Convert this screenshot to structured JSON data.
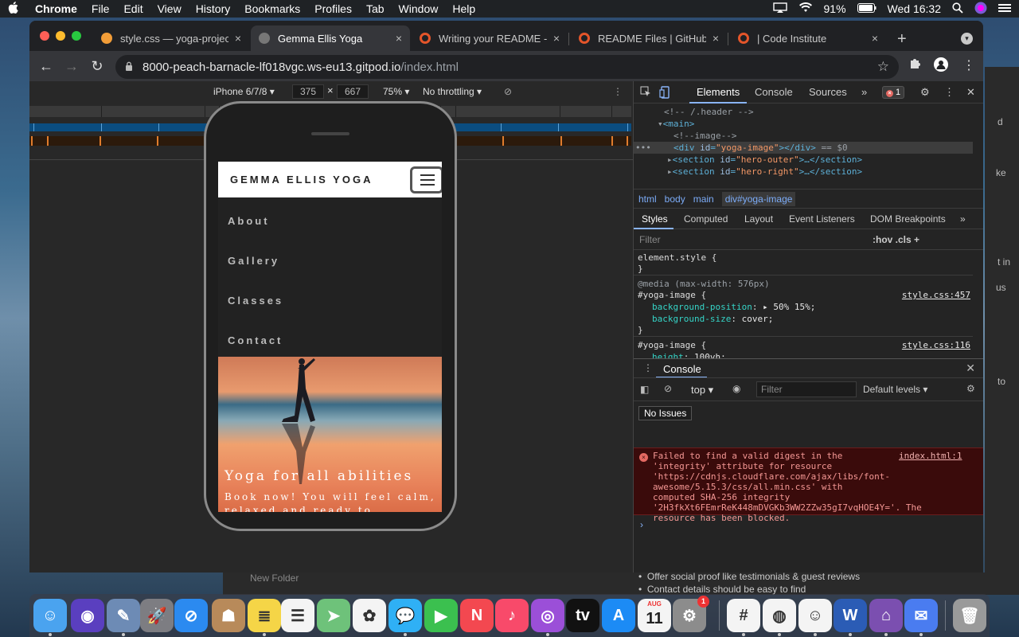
{
  "menubar": {
    "apple": "",
    "items": [
      "Chrome",
      "File",
      "Edit",
      "View",
      "History",
      "Bookmarks",
      "Profiles",
      "Tab",
      "Window",
      "Help"
    ],
    "battery": "91%",
    "clock": "Wed 16:32"
  },
  "tabs": [
    {
      "label": "style.css — yoga-projec",
      "icon_color": "#f29d38",
      "close": "×"
    },
    {
      "label": "Gemma Ellis Yoga",
      "icon_color": "#777777",
      "close": "×",
      "active": true
    },
    {
      "label": "Writing your README - ",
      "icon_color": "#e4552a",
      "close": "×"
    },
    {
      "label": "README Files | GitHub ",
      "icon_color": "#e4552a",
      "close": "×"
    },
    {
      "label": "| Code Institute",
      "icon_color": "#e4552a",
      "close": "×"
    }
  ],
  "newtab": "+",
  "omnibox": {
    "host": "8000-peach-barnacle-lf018vgc.ws-eu13.gitpod.io",
    "path": "/index.html"
  },
  "device_toolbar": {
    "device": "iPhone 6/7/8 ▾",
    "width": "375",
    "height": "667",
    "times": "×",
    "zoom": "75% ▾",
    "throttle": "No throttling ▾"
  },
  "site": {
    "brand": "GEMMA ELLIS YOGA",
    "nav": [
      "About",
      "Gallery",
      "Classes",
      "Contact"
    ],
    "hero_title": "Yoga for all abilities",
    "hero_sub": "Book now! You will feel calm, relaxed and ready to"
  },
  "devtools": {
    "tabs": [
      "Elements",
      "Console",
      "Sources",
      "»"
    ],
    "error_count": "1",
    "dom": [
      {
        "indent": 38,
        "comment": "<!-- /.header -->"
      },
      {
        "indent": 30,
        "arrow": "▾",
        "open": "<main>"
      },
      {
        "indent": 50,
        "comment": "<!--image-->"
      },
      {
        "indent": 50,
        "tag": "div",
        "attr": "id",
        "val": "\"yoga-image\"",
        "close": "></div>",
        "suffix": " == $0",
        "selected": true
      },
      {
        "indent": 42,
        "arrow": "▸",
        "tag": "section",
        "attr": "id",
        "val": "\"hero-outer\"",
        "close": ">…</section>"
      },
      {
        "indent": 42,
        "arrow": "▸",
        "tag": "section",
        "attr": "id",
        "val": "\"hero-right\"",
        "close": ">…</section>"
      }
    ],
    "breadcrumbs": [
      "html",
      "body",
      "main",
      "div#yoga-image"
    ],
    "subtabs": [
      "Styles",
      "Computed",
      "Layout",
      "Event Listeners",
      "DOM Breakpoints",
      "»"
    ],
    "filter_placeholder": "Filter",
    "filter_tools": ":hov  .cls  +",
    "element_style": "element.style {",
    "media": "@media (max-width: 576px)",
    "rule1_selector": "#yoga-image {",
    "rule1_src": "style.css:457",
    "rule1_p1": "background-position",
    "rule1_v1": "▸ 50% 15%;",
    "rule1_p2": "background-size",
    "rule1_v2": "cover;",
    "rule2_selector": "#yoga-image {",
    "rule2_src": "style.css:116",
    "rule2_p1": "height",
    "rule2_v1": "100vh;",
    "brace": "}",
    "drawer_title": "Console",
    "context": "top ▾",
    "console_filter": "Filter",
    "levels": "Default levels ▾",
    "no_issues": "No Issues",
    "error_source": "index.html:1",
    "error_text": "Failed to find a valid digest in the\n'integrity' attribute for resource 'https://cdnjs.cloudflare.com/ajax/libs/font-awesome/5.15.3/css/all.min.css' with\ncomputed SHA-256 integrity\n'2H3fkXt6FEmrReK448mDVGKb3WW2ZZw35gI7vqHOE4Y='. The\nresource has been blocked.",
    "prompt": "›"
  },
  "background": {
    "new_folder": "New Folder",
    "bullet1": "Offer social proof like testimonials & guest reviews",
    "bullet2": "Contact details should be easy to find",
    "frags": [
      "d",
      "ke",
      "t in",
      "us",
      "to"
    ]
  },
  "dock": [
    {
      "name": "finder",
      "color": "#4aa3ef",
      "glyph": "☺"
    },
    {
      "name": "siri",
      "color": "#5a3fbf",
      "glyph": "◉"
    },
    {
      "name": "preview",
      "color": "#6d8bb5",
      "glyph": "✎"
    },
    {
      "name": "launchpad",
      "color": "#7d7d82",
      "glyph": "🚀"
    },
    {
      "name": "safari",
      "color": "#2b8af0",
      "glyph": "⊘"
    },
    {
      "name": "contacts",
      "color": "#b88a5a",
      "glyph": "☗"
    },
    {
      "name": "notes",
      "color": "#f5d547",
      "glyph": "≣"
    },
    {
      "name": "reminders",
      "color": "#f4f4f4",
      "glyph": "☰"
    },
    {
      "name": "maps",
      "color": "#6ec27a",
      "glyph": "➤"
    },
    {
      "name": "photos",
      "color": "#f4f4f4",
      "glyph": "✿"
    },
    {
      "name": "messages",
      "color": "#2fb0f5",
      "glyph": "💬"
    },
    {
      "name": "facetime",
      "color": "#3bc04f",
      "glyph": "▶"
    },
    {
      "name": "news",
      "color": "#f34850",
      "glyph": "N"
    },
    {
      "name": "music",
      "color": "#f84a6a",
      "glyph": "♪"
    },
    {
      "name": "podcasts",
      "color": "#9b4fd8",
      "glyph": "◎"
    },
    {
      "name": "tv",
      "color": "#111111",
      "glyph": "tv"
    },
    {
      "name": "app-store",
      "color": "#1c8bf5",
      "glyph": "A"
    },
    {
      "name": "calendar",
      "color": "#f4f4f4",
      "glyph": "11"
    },
    {
      "name": "system-preferences",
      "color": "#8c8c8c",
      "glyph": "⚙"
    },
    {
      "name": "slack",
      "color": "#f4f4f4",
      "glyph": "#"
    },
    {
      "name": "chrome",
      "color": "#f4f4f4",
      "glyph": "◍"
    },
    {
      "name": "emoji-app",
      "color": "#f4f4f4",
      "glyph": "☺"
    },
    {
      "name": "word",
      "color": "#2b5cb5",
      "glyph": "W"
    },
    {
      "name": "github-desktop",
      "color": "#7b4fb0",
      "glyph": "⌂"
    },
    {
      "name": "messenger",
      "color": "#4a7cf0",
      "glyph": "✉"
    },
    {
      "name": "trash",
      "color": "#9a9a9a",
      "glyph": "🗑"
    }
  ],
  "calendar_month": "AUG",
  "sysprefs_badge": "1"
}
